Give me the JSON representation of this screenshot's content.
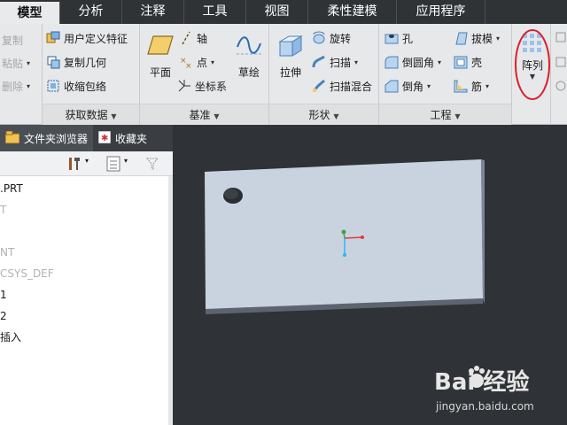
{
  "tabs": [
    {
      "label": "模型",
      "active": true
    },
    {
      "label": "分析",
      "active": false
    },
    {
      "label": "注释",
      "active": false
    },
    {
      "label": "工具",
      "active": false
    },
    {
      "label": "视图",
      "active": false
    },
    {
      "label": "柔性建模",
      "active": false
    },
    {
      "label": "应用程序",
      "active": false
    }
  ],
  "ribbon": {
    "clipboard": {
      "copy": "复制",
      "paste": "粘贴",
      "delete": "删除"
    },
    "get_data": {
      "label": "获取数据",
      "items": [
        "用户定义特征",
        "复制几何",
        "收缩包络"
      ]
    },
    "datum": {
      "label": "基准",
      "plane": "平面",
      "axis": "轴",
      "point": "点",
      "csys": "坐标系",
      "sketch": "草绘"
    },
    "shapes": {
      "label": "形状",
      "extrude": "拉伸",
      "revolve": "旋转",
      "sweep": "扫描",
      "swept_blend": "扫描混合"
    },
    "engineering": {
      "label": "工程",
      "hole": "孔",
      "round": "倒圆角",
      "chamfer": "倒角",
      "draft": "拔模",
      "shell": "壳",
      "rib": "筋"
    },
    "pattern": {
      "label": "阵列"
    }
  },
  "left_pane": {
    "tabs": [
      {
        "label": "文件夹浏览器"
      },
      {
        "label": "收藏夹"
      }
    ],
    "tree": [
      {
        "text": ".PRT",
        "dim": false
      },
      {
        "text": "T",
        "dim": true
      },
      {
        "text": "",
        "dim": false
      },
      {
        "text": "NT",
        "dim": true
      },
      {
        "text": "CSYS_DEF",
        "dim": true
      },
      {
        "text": "1",
        "dim": false
      },
      {
        "text": "2",
        "dim": false
      },
      {
        "text": "插入",
        "dim": false
      }
    ]
  },
  "watermark": {
    "brand": "Bai  经验",
    "url": "jingyan.baidu.com"
  },
  "colors": {
    "tab_bar": "#2f3336",
    "ribbon_bg": "#e7e8ea",
    "graphics_bg": "#2f3236",
    "part_face": "#c9d3e0",
    "highlight_circle": "#d9232e"
  }
}
